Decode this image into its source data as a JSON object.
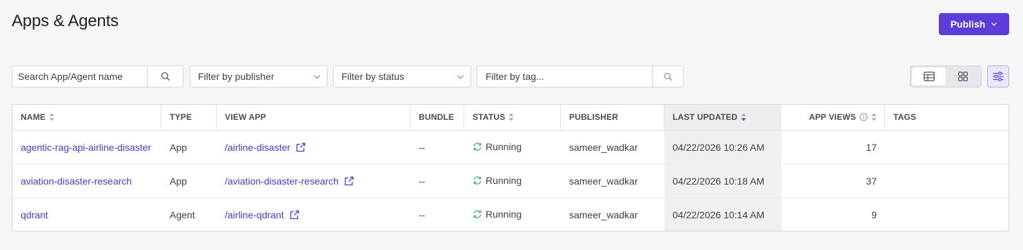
{
  "page": {
    "title": "Apps & Agents"
  },
  "header": {
    "publish_label": "Publish"
  },
  "filters": {
    "search_placeholder": "Search App/Agent name",
    "publisher_label": "Filter by publisher",
    "status_label": "Filter by status",
    "tag_placeholder": "Filter by tag..."
  },
  "colors": {
    "accent": "#5c3ddc",
    "link": "#5235c8",
    "running": "#3bb56b"
  },
  "table": {
    "columns": {
      "name": "NAME",
      "type": "TYPE",
      "view_app": "VIEW APP",
      "bundle": "BUNDLE",
      "status": "STATUS",
      "publisher": "PUBLISHER",
      "last_updated": "LAST UPDATED",
      "app_views": "APP VIEWS",
      "tags": "TAGS"
    },
    "rows": [
      {
        "name": "agentic-rag-api-airline-disaster",
        "type": "App",
        "view_app": "/airline-disaster",
        "bundle": "--",
        "status": "Running",
        "publisher": "sameer_wadkar",
        "last_updated": "04/22/2026 10:26 AM",
        "app_views": "17",
        "tags": ""
      },
      {
        "name": "aviation-disaster-research",
        "type": "App",
        "view_app": "/aviation-disaster-research",
        "bundle": "--",
        "status": "Running",
        "publisher": "sameer_wadkar",
        "last_updated": "04/22/2026 10:18 AM",
        "app_views": "37",
        "tags": ""
      },
      {
        "name": "qdrant",
        "type": "Agent",
        "view_app": "/airline-qdrant",
        "bundle": "--",
        "status": "Running",
        "publisher": "sameer_wadkar",
        "last_updated": "04/22/2026 10:14 AM",
        "app_views": "9",
        "tags": ""
      }
    ]
  }
}
